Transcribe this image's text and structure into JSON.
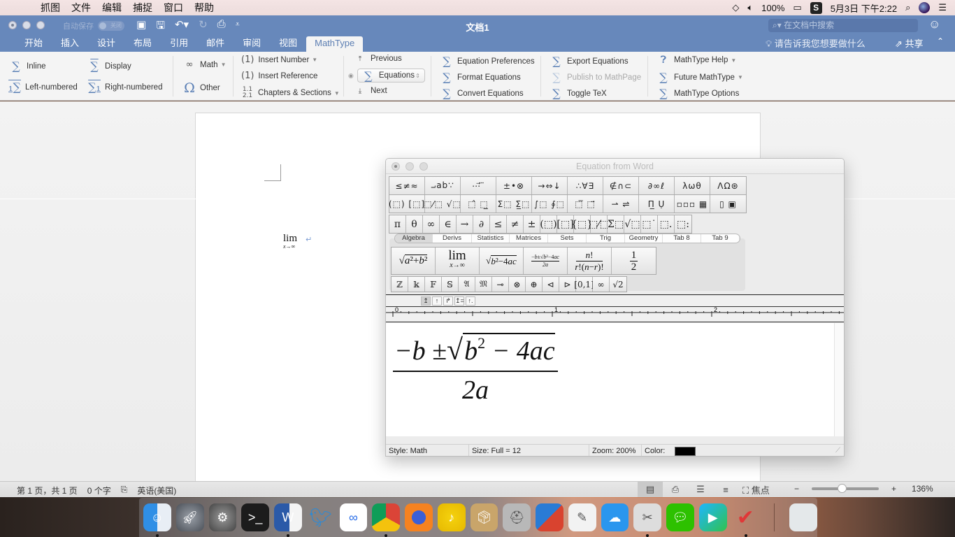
{
  "menubar": {
    "app_menus": [
      "抓图",
      "文件",
      "编辑",
      "捕捉",
      "窗口",
      "帮助"
    ],
    "battery": "100%",
    "datetime": "5月3日 下午2:22",
    "status_icons": [
      "wifi-icon",
      "volume-icon",
      "battery-charging-icon",
      "sogou-input-icon",
      "spotlight-search-icon",
      "siri-icon",
      "notification-list-icon"
    ]
  },
  "word": {
    "title": "文档1",
    "autosave_label": "自动保存",
    "autosave_state": "关闭",
    "search_placeholder": "在文档中搜索",
    "tabs": [
      "开始",
      "插入",
      "设计",
      "布局",
      "引用",
      "邮件",
      "审阅",
      "视图",
      "MathType"
    ],
    "active_tab": "MathType",
    "tell_me": "请告诉我您想要做什么",
    "share": "共享"
  },
  "ribbon": {
    "inline": "Inline",
    "display": "Display",
    "left_numbered": "Left-numbered",
    "right_numbered": "Right-numbered",
    "math": "Math",
    "other": "Other",
    "insert_number": "Insert Number",
    "insert_reference": "Insert Reference",
    "chapters_sections": "Chapters & Sections",
    "previous": "Previous",
    "equations": "Equations",
    "next": "Next",
    "equation_preferences": "Equation Preferences",
    "format_equations": "Format Equations",
    "convert_equations": "Convert Equations",
    "export_equations": "Export Equations",
    "publish_mathpage": "Publish to MathPage",
    "toggle_tex": "Toggle TeX",
    "mathtype_help": "MathType Help",
    "future_mathtype": "Future MathType",
    "mathtype_options": "MathType Options"
  },
  "document": {
    "equation_main": "lim",
    "equation_sub": "x→∞"
  },
  "mathtype": {
    "window_title": "Equation from Word",
    "palette_row1": [
      "≤≠≈",
      "⨼ab∵",
      "⋯⃗ ⃛",
      "±•⊗",
      "→⇔↓",
      "∴∀∃",
      "∉∩⊂",
      "∂∞ℓ",
      "λωθ",
      "ΛΩ⊛"
    ],
    "palette_row2": [
      "(⬚) [⬚]",
      "⬚⁄⬚ √⬚",
      "⬚̂ ⬚̲",
      "Σ⬚ Σ̲⬚",
      "∫⬚ ∮⬚",
      "⬚̅ ⬚⃗",
      "⇀ ⇌",
      "Π̲ Ụ",
      "▫▫▫ ▦",
      "▯ ▣"
    ],
    "palette_small": [
      "π",
      "θ",
      "∞",
      "∈",
      "→",
      "∂",
      "≤",
      "≠",
      "±",
      "(⬚)",
      "[⬚]",
      "{⬚}",
      "⬚⁄⬚",
      "Σ̇⬚",
      "√⬚",
      "⬚˙",
      "⬚.",
      "⬚:"
    ],
    "tabs": [
      "Algebra",
      "Derivs",
      "Statistics",
      "Matrices",
      "Sets",
      "Trig",
      "Geometry",
      "Tab 8",
      "Tab 9"
    ],
    "active_tab": "Algebra",
    "templates": [
      "√(a²+b²)",
      "lim x→∞",
      "√(b²−4ac)",
      "(−b±√(b²−4ac))/2a",
      "n!/(r!(n−r)!)",
      "1/2"
    ],
    "symbols": [
      "ℤ",
      "𝕜",
      "𝔽",
      "𝕊",
      "𝔄",
      "𝔐",
      "⊸",
      "⊗",
      "⊕",
      "⊲",
      "⊳",
      "[0,1]",
      "∞",
      "√2"
    ],
    "tabstop_buttons": [
      "left-align-tab",
      "center-tab",
      "right-tab",
      "equals-tab",
      "decimal-tab"
    ],
    "ruler_labels": [
      "0",
      "1",
      "2"
    ],
    "equation": {
      "numerator_prefix": "−b ± ",
      "radicand_base": "b",
      "radicand_exp": "2",
      "radicand_rest": " − 4ac",
      "denominator": "2a"
    },
    "status": {
      "style": "Style: Math",
      "size": "Size: Full = 12",
      "zoom": "Zoom: 200%",
      "color_label": "Color:",
      "color_value": "#000000"
    }
  },
  "statusbar": {
    "page": "第 1 页，共 1 页",
    "words": "0 个字",
    "language": "英语(美国)",
    "focus": "焦点",
    "zoom": "136%",
    "zoom_fraction": 0.45
  },
  "dock": {
    "apps": [
      "Finder",
      "Launchpad",
      "System Preferences",
      "Terminal",
      "Microsoft Word",
      "Migrate",
      "Baidu Netdisk",
      "Google Chrome",
      "Firefox",
      "QQ Music",
      "Archive Utility",
      "Disk Utility",
      "VMware Fusion",
      "TextEdit",
      "iCloud",
      "Snipping Tool",
      "WeChat",
      "Tencent Video",
      "WPS",
      "Trash"
    ]
  }
}
